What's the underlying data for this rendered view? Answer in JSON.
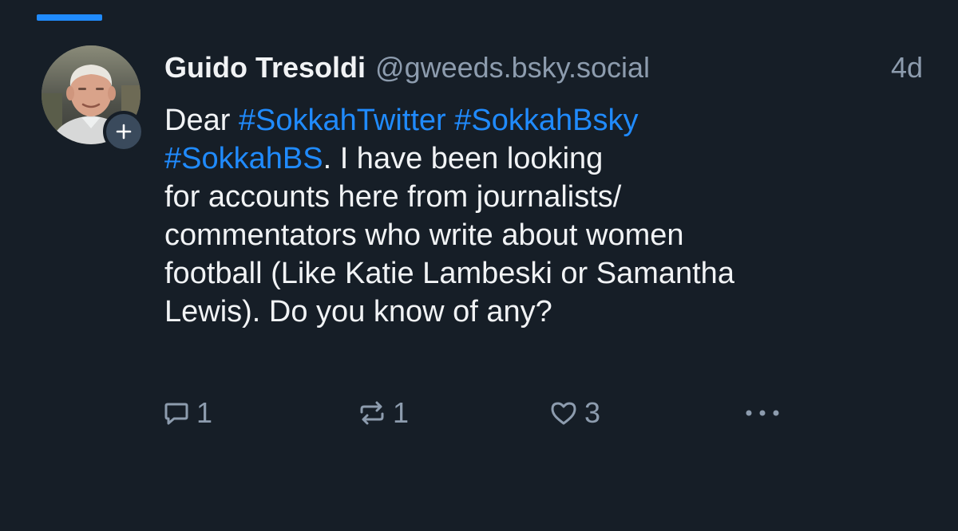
{
  "post": {
    "author": {
      "display_name": "Guido Tresoldi",
      "handle": "@gweeds.bsky.social"
    },
    "timestamp": "4d",
    "body": {
      "line1": {
        "prefix": "Dear ",
        "hashtag1": "#SokkahTwitter",
        "space": " ",
        "hashtag2": "#SokkahBsky"
      },
      "line2": {
        "hashtag": "#SokkahBS",
        "suffix": ". I have been looking"
      },
      "line3": "for accounts here from journalists/",
      "line4": "commentators who write about women",
      "line5": "football (Like Katie Lambeski or Samantha",
      "line6": "Lewis). Do you know of any?"
    },
    "actions": {
      "reply_count": "1",
      "repost_count": "1",
      "like_count": "3"
    }
  },
  "colors": {
    "background": "#161e27",
    "accent": "#208bfe",
    "text_primary": "#f1f3f5",
    "text_secondary": "#8d9cae"
  },
  "icons": {
    "reply": "reply-icon",
    "repost": "repost-icon",
    "like": "heart-icon",
    "more": "more-dots-icon",
    "follow": "plus-icon"
  }
}
